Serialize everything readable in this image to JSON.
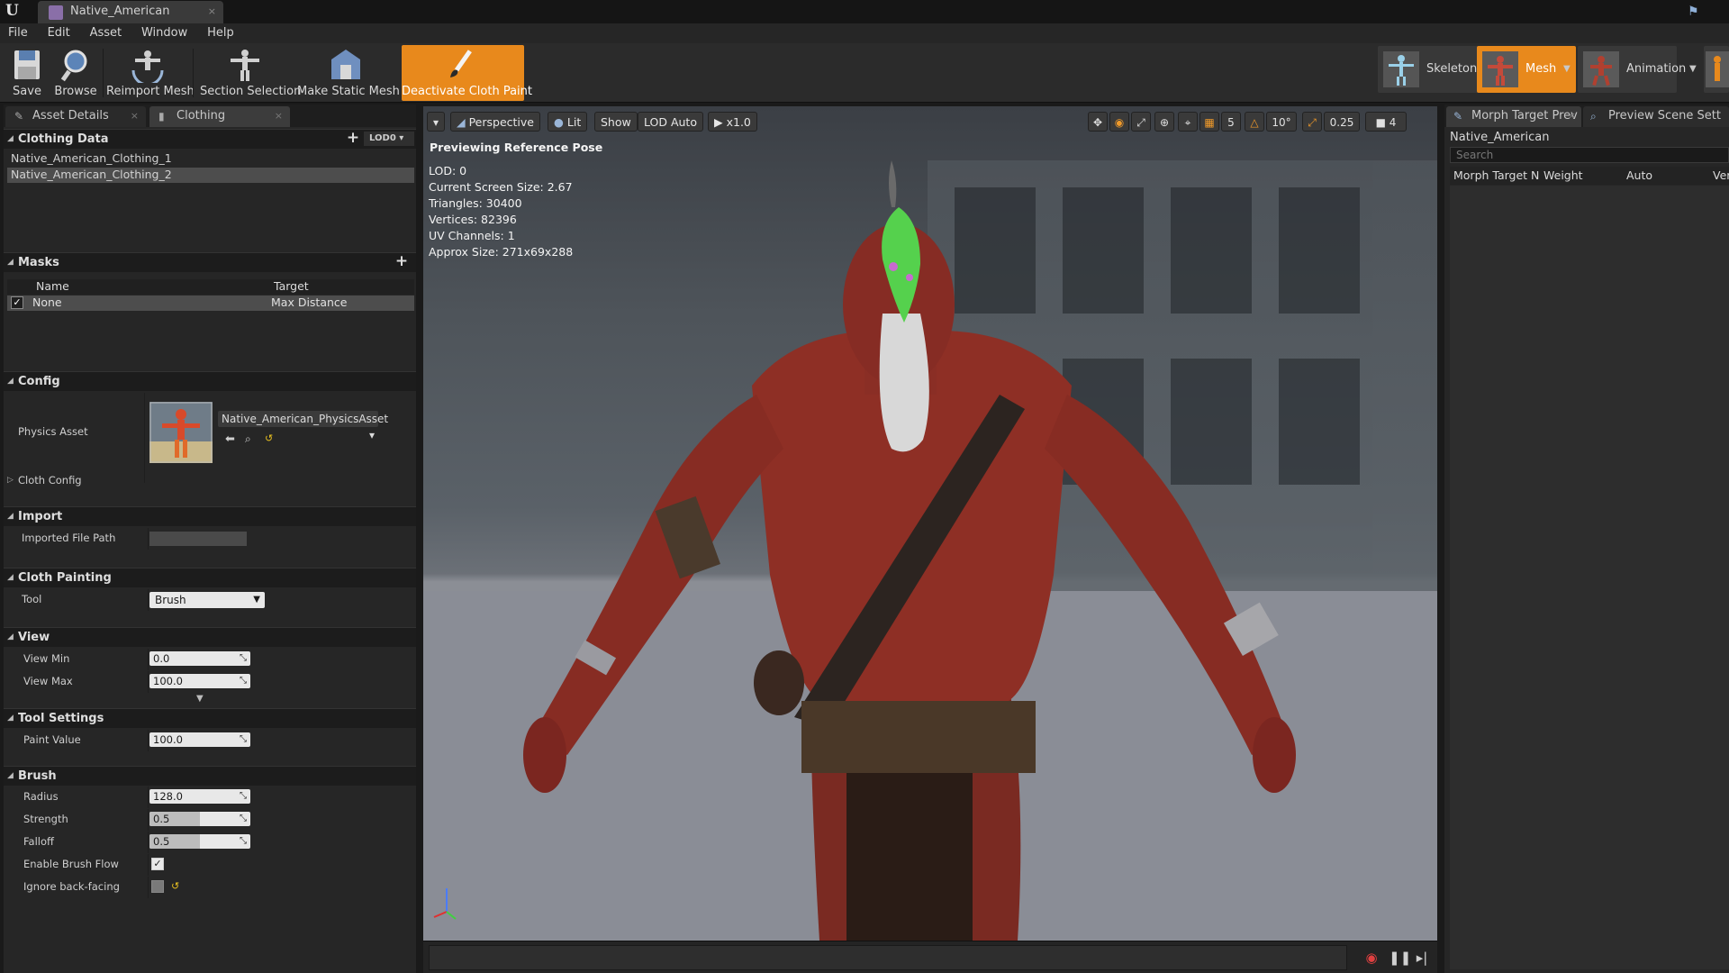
{
  "window": {
    "tab_title": "Native_American",
    "tab_close": "×"
  },
  "menu": [
    "File",
    "Edit",
    "Asset",
    "Window",
    "Help"
  ],
  "toolbar": {
    "save": "Save",
    "browse": "Browse",
    "reimport": "Reimport Mesh",
    "section": "Section Selection",
    "make_static": "Make Static Mesh",
    "deactivate": "Deactivate Cloth Paint"
  },
  "modes": {
    "skeleton": "Skeleton",
    "mesh": "Mesh",
    "animation": "Animation"
  },
  "left_tabs": {
    "asset_details": "Asset Details",
    "clothing": "Clothing"
  },
  "clothing_data": {
    "header": "Clothing Data",
    "lod": "LOD0",
    "items": [
      "Native_American_Clothing_1",
      "Native_American_Clothing_2"
    ]
  },
  "masks": {
    "header": "Masks",
    "col_name": "Name",
    "col_target": "Target",
    "rows": [
      {
        "name": "None",
        "target": "Max Distance",
        "checked": "✓"
      }
    ]
  },
  "config": {
    "header": "Config",
    "physics_asset_label": "Physics Asset",
    "physics_asset_value": "Native_American_PhysicsAsset",
    "cloth_config": "Cloth Config"
  },
  "import": {
    "header": "Import",
    "file_path_label": "Imported File Path",
    "file_path_value": ""
  },
  "cloth_painting": {
    "header": "Cloth Painting",
    "tool_label": "Tool",
    "tool_value": "Brush"
  },
  "view": {
    "header": "View",
    "min_label": "View Min",
    "min_value": "0.0",
    "max_label": "View Max",
    "max_value": "100.0"
  },
  "tool_settings": {
    "header": "Tool Settings",
    "paint_label": "Paint Value",
    "paint_value": "100.0"
  },
  "brush": {
    "header": "Brush",
    "radius_label": "Radius",
    "radius_value": "128.0",
    "strength_label": "Strength",
    "strength_value": "0.5",
    "strength_fraction": 0.5,
    "falloff_label": "Falloff",
    "falloff_value": "0.5",
    "falloff_fraction": 0.5,
    "flow_label": "Enable Brush Flow",
    "flow_checked": "✓",
    "backface_label": "Ignore back-facing"
  },
  "viewport": {
    "perspective": "Perspective",
    "lit": "Lit",
    "show": "Show",
    "lod": "LOD Auto",
    "speed": "x1.0",
    "grid_value": "5",
    "angle_value": "10°",
    "scale_value": "0.25",
    "camera_speed": "4",
    "pose_label": "Previewing Reference Pose",
    "stats": [
      "LOD: 0",
      "Current Screen Size: 2.67",
      "Triangles: 30400",
      "Vertices: 82396",
      "UV Channels: 1",
      "Approx Size: 271x69x288"
    ]
  },
  "right_tabs": {
    "morph": "Morph Target Prev",
    "scene": "Preview Scene Sett"
  },
  "morph": {
    "asset": "Native_American",
    "search_placeholder": "Search",
    "col_name": "Morph Target N",
    "col_weight": "Weight",
    "col_auto": "Auto",
    "col_vert": "Vert"
  },
  "colors": {
    "accent_orange": "#e8891c",
    "paint_green": "#55d14d",
    "skin_red": "#8b2e24"
  }
}
